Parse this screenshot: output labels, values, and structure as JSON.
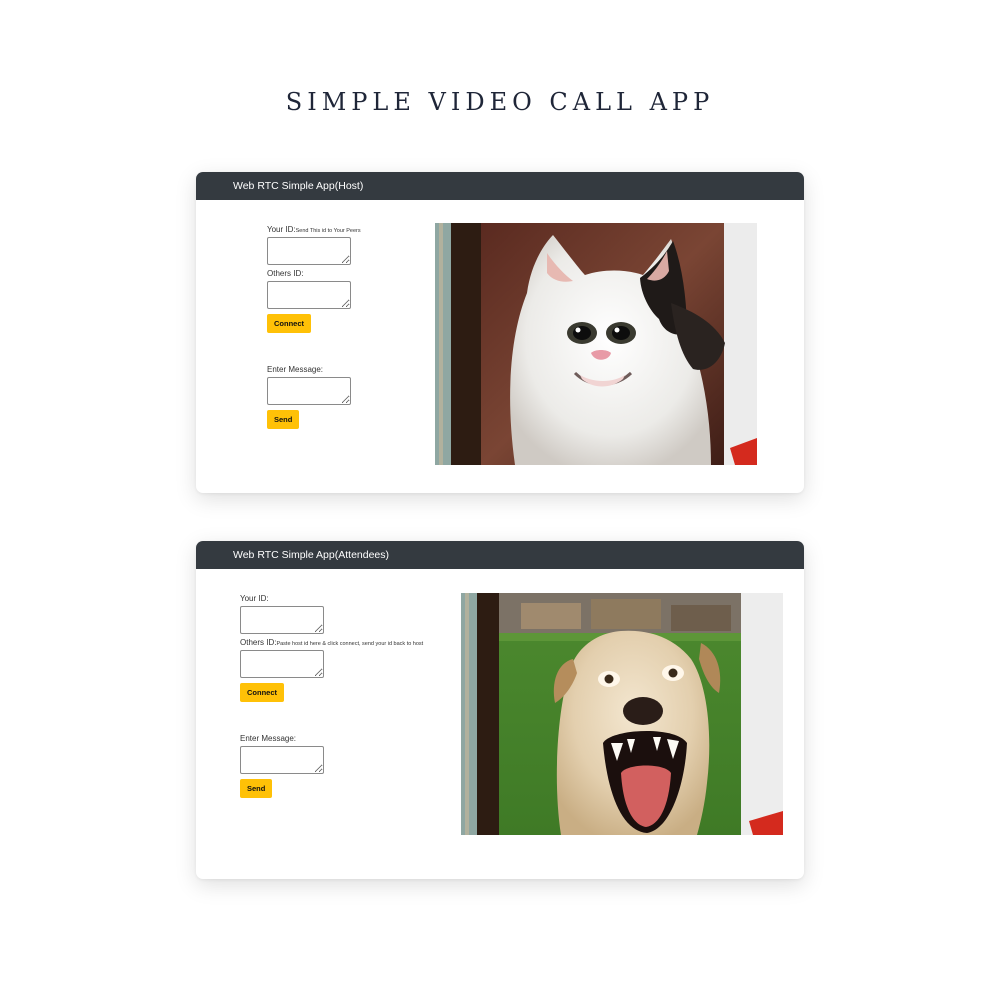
{
  "page": {
    "title": "SIMPLE VIDEO CALL APP"
  },
  "host_app": {
    "navbar_title": "Web RTC Simple App(Host)",
    "your_id_label": "Your ID:",
    "your_id_hint": "Send This id to Your Peers",
    "your_id_value": "",
    "others_id_label": "Others ID:",
    "others_id_value": "",
    "connect_label": "Connect",
    "message_label": "Enter Message:",
    "message_value": "",
    "send_label": "Send"
  },
  "attendee_app": {
    "navbar_title": "Web RTC Simple App(Attendees)",
    "your_id_label": "Your ID:",
    "your_id_value": "",
    "others_id_label": "Others ID:",
    "others_id_hint": "Paste host id here & click connect, send your id back to host",
    "others_id_value": "",
    "connect_label": "Connect",
    "message_label": "Enter Message:",
    "message_value": "",
    "send_label": "Send"
  },
  "colors": {
    "navbar_bg": "#343a40",
    "button_bg": "#ffc107",
    "title_text": "#1f2638"
  }
}
